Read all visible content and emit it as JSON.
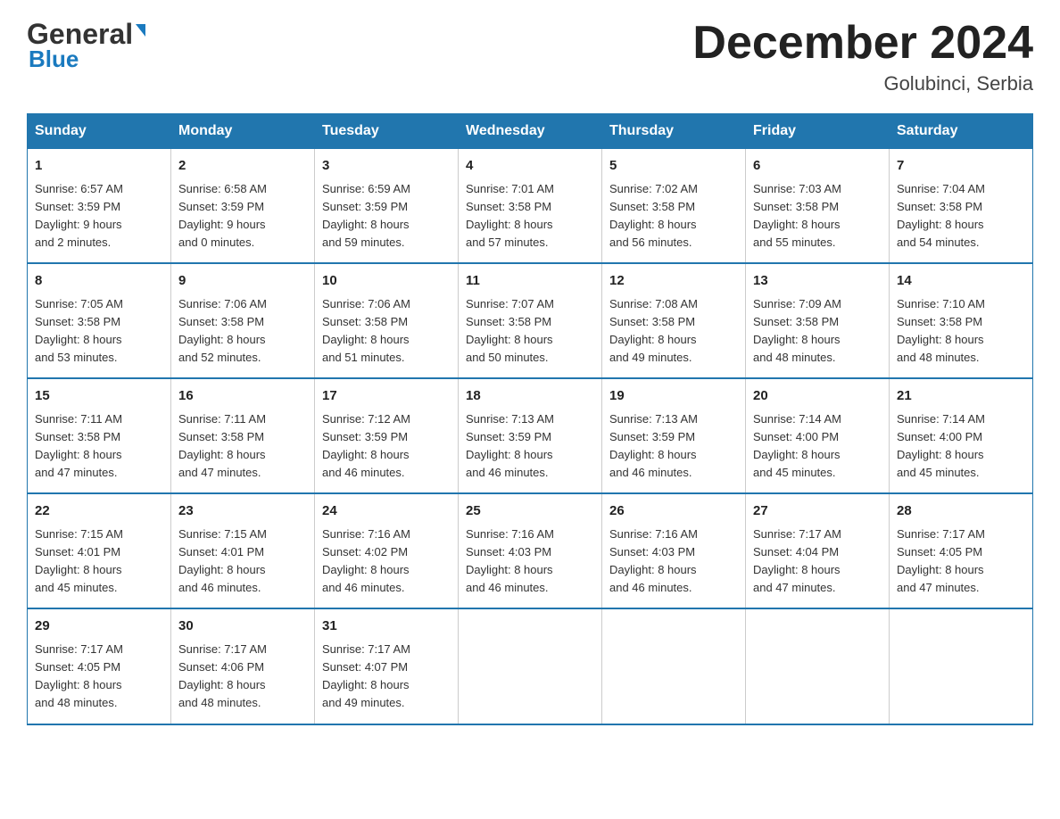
{
  "logo": {
    "general": "General",
    "blue": "Blue",
    "triangle_char": "▲"
  },
  "title": "December 2024",
  "location": "Golubinci, Serbia",
  "days_of_week": [
    "Sunday",
    "Monday",
    "Tuesday",
    "Wednesday",
    "Thursday",
    "Friday",
    "Saturday"
  ],
  "weeks": [
    [
      {
        "day": "1",
        "info": "Sunrise: 6:57 AM\nSunset: 3:59 PM\nDaylight: 9 hours\nand 2 minutes."
      },
      {
        "day": "2",
        "info": "Sunrise: 6:58 AM\nSunset: 3:59 PM\nDaylight: 9 hours\nand 0 minutes."
      },
      {
        "day": "3",
        "info": "Sunrise: 6:59 AM\nSunset: 3:59 PM\nDaylight: 8 hours\nand 59 minutes."
      },
      {
        "day": "4",
        "info": "Sunrise: 7:01 AM\nSunset: 3:58 PM\nDaylight: 8 hours\nand 57 minutes."
      },
      {
        "day": "5",
        "info": "Sunrise: 7:02 AM\nSunset: 3:58 PM\nDaylight: 8 hours\nand 56 minutes."
      },
      {
        "day": "6",
        "info": "Sunrise: 7:03 AM\nSunset: 3:58 PM\nDaylight: 8 hours\nand 55 minutes."
      },
      {
        "day": "7",
        "info": "Sunrise: 7:04 AM\nSunset: 3:58 PM\nDaylight: 8 hours\nand 54 minutes."
      }
    ],
    [
      {
        "day": "8",
        "info": "Sunrise: 7:05 AM\nSunset: 3:58 PM\nDaylight: 8 hours\nand 53 minutes."
      },
      {
        "day": "9",
        "info": "Sunrise: 7:06 AM\nSunset: 3:58 PM\nDaylight: 8 hours\nand 52 minutes."
      },
      {
        "day": "10",
        "info": "Sunrise: 7:06 AM\nSunset: 3:58 PM\nDaylight: 8 hours\nand 51 minutes."
      },
      {
        "day": "11",
        "info": "Sunrise: 7:07 AM\nSunset: 3:58 PM\nDaylight: 8 hours\nand 50 minutes."
      },
      {
        "day": "12",
        "info": "Sunrise: 7:08 AM\nSunset: 3:58 PM\nDaylight: 8 hours\nand 49 minutes."
      },
      {
        "day": "13",
        "info": "Sunrise: 7:09 AM\nSunset: 3:58 PM\nDaylight: 8 hours\nand 48 minutes."
      },
      {
        "day": "14",
        "info": "Sunrise: 7:10 AM\nSunset: 3:58 PM\nDaylight: 8 hours\nand 48 minutes."
      }
    ],
    [
      {
        "day": "15",
        "info": "Sunrise: 7:11 AM\nSunset: 3:58 PM\nDaylight: 8 hours\nand 47 minutes."
      },
      {
        "day": "16",
        "info": "Sunrise: 7:11 AM\nSunset: 3:58 PM\nDaylight: 8 hours\nand 47 minutes."
      },
      {
        "day": "17",
        "info": "Sunrise: 7:12 AM\nSunset: 3:59 PM\nDaylight: 8 hours\nand 46 minutes."
      },
      {
        "day": "18",
        "info": "Sunrise: 7:13 AM\nSunset: 3:59 PM\nDaylight: 8 hours\nand 46 minutes."
      },
      {
        "day": "19",
        "info": "Sunrise: 7:13 AM\nSunset: 3:59 PM\nDaylight: 8 hours\nand 46 minutes."
      },
      {
        "day": "20",
        "info": "Sunrise: 7:14 AM\nSunset: 4:00 PM\nDaylight: 8 hours\nand 45 minutes."
      },
      {
        "day": "21",
        "info": "Sunrise: 7:14 AM\nSunset: 4:00 PM\nDaylight: 8 hours\nand 45 minutes."
      }
    ],
    [
      {
        "day": "22",
        "info": "Sunrise: 7:15 AM\nSunset: 4:01 PM\nDaylight: 8 hours\nand 45 minutes."
      },
      {
        "day": "23",
        "info": "Sunrise: 7:15 AM\nSunset: 4:01 PM\nDaylight: 8 hours\nand 46 minutes."
      },
      {
        "day": "24",
        "info": "Sunrise: 7:16 AM\nSunset: 4:02 PM\nDaylight: 8 hours\nand 46 minutes."
      },
      {
        "day": "25",
        "info": "Sunrise: 7:16 AM\nSunset: 4:03 PM\nDaylight: 8 hours\nand 46 minutes."
      },
      {
        "day": "26",
        "info": "Sunrise: 7:16 AM\nSunset: 4:03 PM\nDaylight: 8 hours\nand 46 minutes."
      },
      {
        "day": "27",
        "info": "Sunrise: 7:17 AM\nSunset: 4:04 PM\nDaylight: 8 hours\nand 47 minutes."
      },
      {
        "day": "28",
        "info": "Sunrise: 7:17 AM\nSunset: 4:05 PM\nDaylight: 8 hours\nand 47 minutes."
      }
    ],
    [
      {
        "day": "29",
        "info": "Sunrise: 7:17 AM\nSunset: 4:05 PM\nDaylight: 8 hours\nand 48 minutes."
      },
      {
        "day": "30",
        "info": "Sunrise: 7:17 AM\nSunset: 4:06 PM\nDaylight: 8 hours\nand 48 minutes."
      },
      {
        "day": "31",
        "info": "Sunrise: 7:17 AM\nSunset: 4:07 PM\nDaylight: 8 hours\nand 49 minutes."
      },
      {
        "day": "",
        "info": ""
      },
      {
        "day": "",
        "info": ""
      },
      {
        "day": "",
        "info": ""
      },
      {
        "day": "",
        "info": ""
      }
    ]
  ]
}
